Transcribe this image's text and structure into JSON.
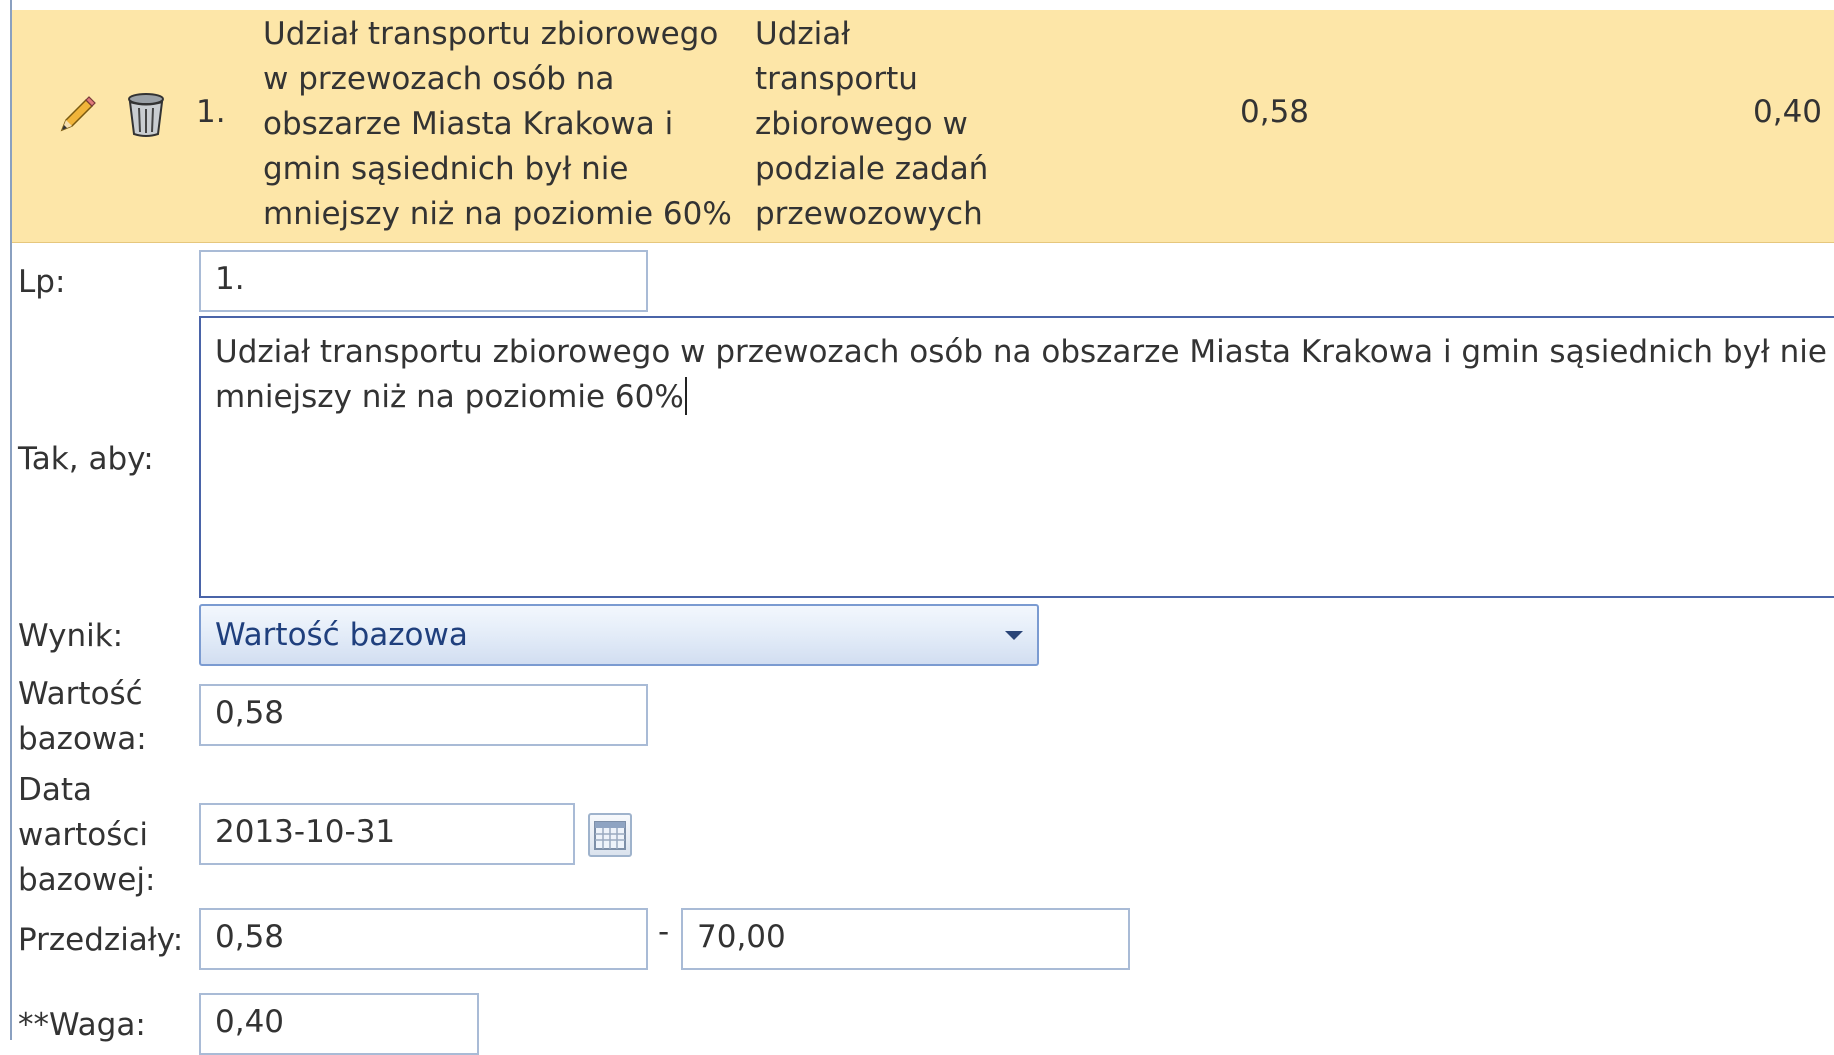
{
  "row": {
    "number": "1.",
    "description_lines": [
      "Udział transportu zbiorowego",
      "w przewozach osób na",
      "obszarze Miasta Krakowa i",
      "gmin sąsiednich był nie",
      "mniejszy niż na poziomie 60%"
    ],
    "indicator_lines": [
      "Udział",
      "transportu",
      "zbiorowego w",
      "podziale zadań",
      "przewozowych"
    ],
    "base_value": "0,58",
    "weight": "0,40",
    "edit_icon": "pencil-icon",
    "delete_icon": "trash-icon"
  },
  "form": {
    "lp": {
      "label": "Lp:",
      "value": "1."
    },
    "tak_aby": {
      "label": "Tak, aby:",
      "value_line1": "Udział transportu zbiorowego w przewozach osób na obszarze Miasta Krakowa i gmin sąsiednich był nie",
      "value_line2": "mniejszy niż na poziomie 60%"
    },
    "wynik": {
      "label": "Wynik:",
      "selected": "Wartość bazowa"
    },
    "wartosc_bazowa": {
      "label_line1": "Wartość",
      "label_line2": "bazowa:",
      "value": "0,58"
    },
    "data_wartosci": {
      "label_line1": "Data",
      "label_line2": "wartości",
      "label_line3": "bazowej:",
      "value": "2013-10-31",
      "icon": "calendar-icon"
    },
    "przedzialy": {
      "label": "Przedziały:",
      "from": "0,58",
      "separator": "-",
      "to": "70,00"
    },
    "waga": {
      "label": "**Waga:",
      "value": "0,40"
    }
  },
  "colors": {
    "row_highlight": "#fde6a8",
    "field_border": "#a9bbd6",
    "focused_border": "#4a64a8",
    "select_text": "#1f3f7d"
  }
}
